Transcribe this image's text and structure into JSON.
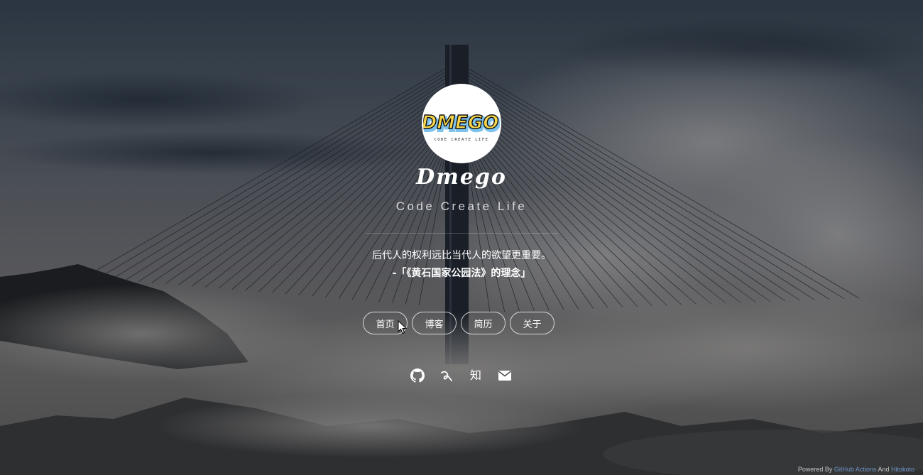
{
  "avatar": {
    "logo_text": "DMEGO",
    "logo_tagline": "CODE CREATE LIFE"
  },
  "site": {
    "title": "Dmego",
    "subtitle": "Code Create Life"
  },
  "hitokoto": {
    "text": "后代人的权利远比当代人的欲望更重要。",
    "source": "-「《黄石国家公园法》的理念」"
  },
  "nav": {
    "items": [
      {
        "label": "首页"
      },
      {
        "label": "博客"
      },
      {
        "label": "简历"
      },
      {
        "label": "关于"
      }
    ]
  },
  "social": {
    "icons": [
      "github-icon",
      "yuque-icon",
      "zhihu-icon",
      "mail-icon"
    ],
    "zhihu_glyph": "知"
  },
  "footer": {
    "prefix": "Powered By",
    "link1": "GitHub Actions",
    "middle": "And",
    "link2": "Hitokoto"
  },
  "colors": {
    "link": "#6f95c8",
    "logo_yellow": "#f7d54a",
    "logo_blue": "#7ec3ec"
  }
}
